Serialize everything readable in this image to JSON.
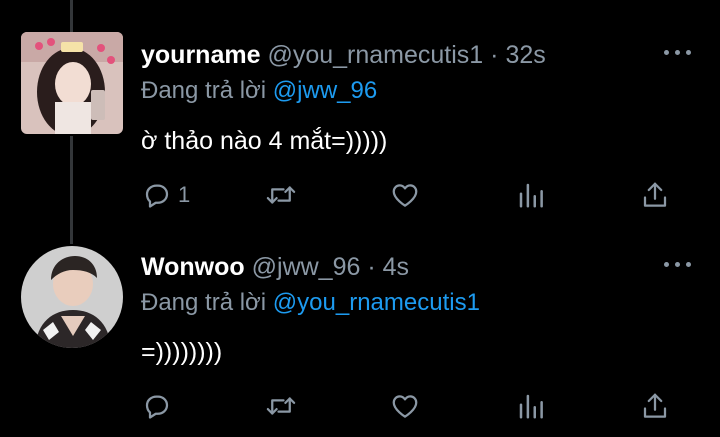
{
  "tweets": [
    {
      "display_name": "yourname",
      "handle": "@you_rnamecutis1",
      "separator": "·",
      "time": "32s",
      "reply_prefix": "Đang trả lời",
      "reply_to": "@jww_96",
      "text": "ờ thảo nào 4 mắt=)))))",
      "reply_count": "1",
      "avatar_icon": "avatar-girl-photo",
      "avatar_shape": "square"
    },
    {
      "display_name": "Wonwoo",
      "handle": "@jww_96",
      "separator": "·",
      "time": "4s",
      "reply_prefix": "Đang trả lời",
      "reply_to": "@you_rnamecutis1",
      "text": "=))))))))",
      "reply_count": "",
      "avatar_icon": "avatar-man-photo",
      "avatar_shape": "round"
    }
  ],
  "icons": [
    "reply-icon",
    "retweet-icon",
    "like-icon",
    "views-icon",
    "share-icon",
    "more-options-icon"
  ],
  "colors": {
    "background": "#000000",
    "text_primary": "#ffffff",
    "text_secondary": "#8b98a5",
    "mention": "#1d9bf0",
    "thread_line": "#333639"
  }
}
